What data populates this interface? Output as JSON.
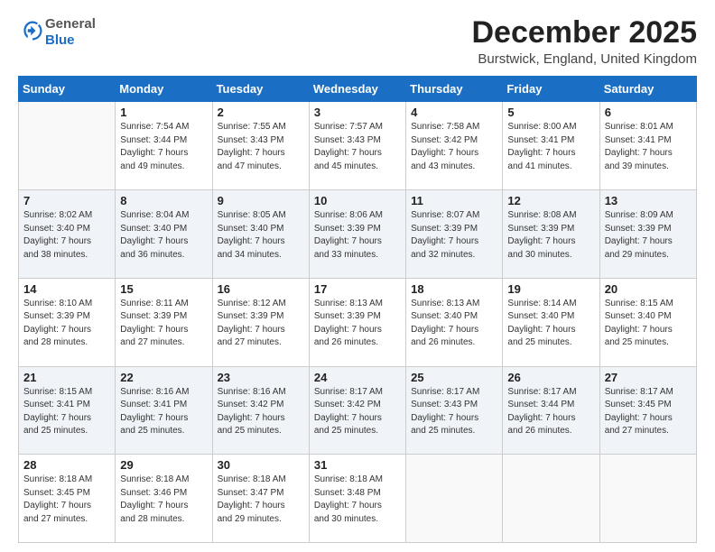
{
  "logo": {
    "general": "General",
    "blue": "Blue"
  },
  "header": {
    "month": "December 2025",
    "location": "Burstwick, England, United Kingdom"
  },
  "days_of_week": [
    "Sunday",
    "Monday",
    "Tuesday",
    "Wednesday",
    "Thursday",
    "Friday",
    "Saturday"
  ],
  "weeks": [
    [
      {
        "day": "",
        "info": ""
      },
      {
        "day": "1",
        "info": "Sunrise: 7:54 AM\nSunset: 3:44 PM\nDaylight: 7 hours\nand 49 minutes."
      },
      {
        "day": "2",
        "info": "Sunrise: 7:55 AM\nSunset: 3:43 PM\nDaylight: 7 hours\nand 47 minutes."
      },
      {
        "day": "3",
        "info": "Sunrise: 7:57 AM\nSunset: 3:43 PM\nDaylight: 7 hours\nand 45 minutes."
      },
      {
        "day": "4",
        "info": "Sunrise: 7:58 AM\nSunset: 3:42 PM\nDaylight: 7 hours\nand 43 minutes."
      },
      {
        "day": "5",
        "info": "Sunrise: 8:00 AM\nSunset: 3:41 PM\nDaylight: 7 hours\nand 41 minutes."
      },
      {
        "day": "6",
        "info": "Sunrise: 8:01 AM\nSunset: 3:41 PM\nDaylight: 7 hours\nand 39 minutes."
      }
    ],
    [
      {
        "day": "7",
        "info": "Sunrise: 8:02 AM\nSunset: 3:40 PM\nDaylight: 7 hours\nand 38 minutes."
      },
      {
        "day": "8",
        "info": "Sunrise: 8:04 AM\nSunset: 3:40 PM\nDaylight: 7 hours\nand 36 minutes."
      },
      {
        "day": "9",
        "info": "Sunrise: 8:05 AM\nSunset: 3:40 PM\nDaylight: 7 hours\nand 34 minutes."
      },
      {
        "day": "10",
        "info": "Sunrise: 8:06 AM\nSunset: 3:39 PM\nDaylight: 7 hours\nand 33 minutes."
      },
      {
        "day": "11",
        "info": "Sunrise: 8:07 AM\nSunset: 3:39 PM\nDaylight: 7 hours\nand 32 minutes."
      },
      {
        "day": "12",
        "info": "Sunrise: 8:08 AM\nSunset: 3:39 PM\nDaylight: 7 hours\nand 30 minutes."
      },
      {
        "day": "13",
        "info": "Sunrise: 8:09 AM\nSunset: 3:39 PM\nDaylight: 7 hours\nand 29 minutes."
      }
    ],
    [
      {
        "day": "14",
        "info": "Sunrise: 8:10 AM\nSunset: 3:39 PM\nDaylight: 7 hours\nand 28 minutes."
      },
      {
        "day": "15",
        "info": "Sunrise: 8:11 AM\nSunset: 3:39 PM\nDaylight: 7 hours\nand 27 minutes."
      },
      {
        "day": "16",
        "info": "Sunrise: 8:12 AM\nSunset: 3:39 PM\nDaylight: 7 hours\nand 27 minutes."
      },
      {
        "day": "17",
        "info": "Sunrise: 8:13 AM\nSunset: 3:39 PM\nDaylight: 7 hours\nand 26 minutes."
      },
      {
        "day": "18",
        "info": "Sunrise: 8:13 AM\nSunset: 3:40 PM\nDaylight: 7 hours\nand 26 minutes."
      },
      {
        "day": "19",
        "info": "Sunrise: 8:14 AM\nSunset: 3:40 PM\nDaylight: 7 hours\nand 25 minutes."
      },
      {
        "day": "20",
        "info": "Sunrise: 8:15 AM\nSunset: 3:40 PM\nDaylight: 7 hours\nand 25 minutes."
      }
    ],
    [
      {
        "day": "21",
        "info": "Sunrise: 8:15 AM\nSunset: 3:41 PM\nDaylight: 7 hours\nand 25 minutes."
      },
      {
        "day": "22",
        "info": "Sunrise: 8:16 AM\nSunset: 3:41 PM\nDaylight: 7 hours\nand 25 minutes."
      },
      {
        "day": "23",
        "info": "Sunrise: 8:16 AM\nSunset: 3:42 PM\nDaylight: 7 hours\nand 25 minutes."
      },
      {
        "day": "24",
        "info": "Sunrise: 8:17 AM\nSunset: 3:42 PM\nDaylight: 7 hours\nand 25 minutes."
      },
      {
        "day": "25",
        "info": "Sunrise: 8:17 AM\nSunset: 3:43 PM\nDaylight: 7 hours\nand 25 minutes."
      },
      {
        "day": "26",
        "info": "Sunrise: 8:17 AM\nSunset: 3:44 PM\nDaylight: 7 hours\nand 26 minutes."
      },
      {
        "day": "27",
        "info": "Sunrise: 8:17 AM\nSunset: 3:45 PM\nDaylight: 7 hours\nand 27 minutes."
      }
    ],
    [
      {
        "day": "28",
        "info": "Sunrise: 8:18 AM\nSunset: 3:45 PM\nDaylight: 7 hours\nand 27 minutes."
      },
      {
        "day": "29",
        "info": "Sunrise: 8:18 AM\nSunset: 3:46 PM\nDaylight: 7 hours\nand 28 minutes."
      },
      {
        "day": "30",
        "info": "Sunrise: 8:18 AM\nSunset: 3:47 PM\nDaylight: 7 hours\nand 29 minutes."
      },
      {
        "day": "31",
        "info": "Sunrise: 8:18 AM\nSunset: 3:48 PM\nDaylight: 7 hours\nand 30 minutes."
      },
      {
        "day": "",
        "info": ""
      },
      {
        "day": "",
        "info": ""
      },
      {
        "day": "",
        "info": ""
      }
    ]
  ]
}
